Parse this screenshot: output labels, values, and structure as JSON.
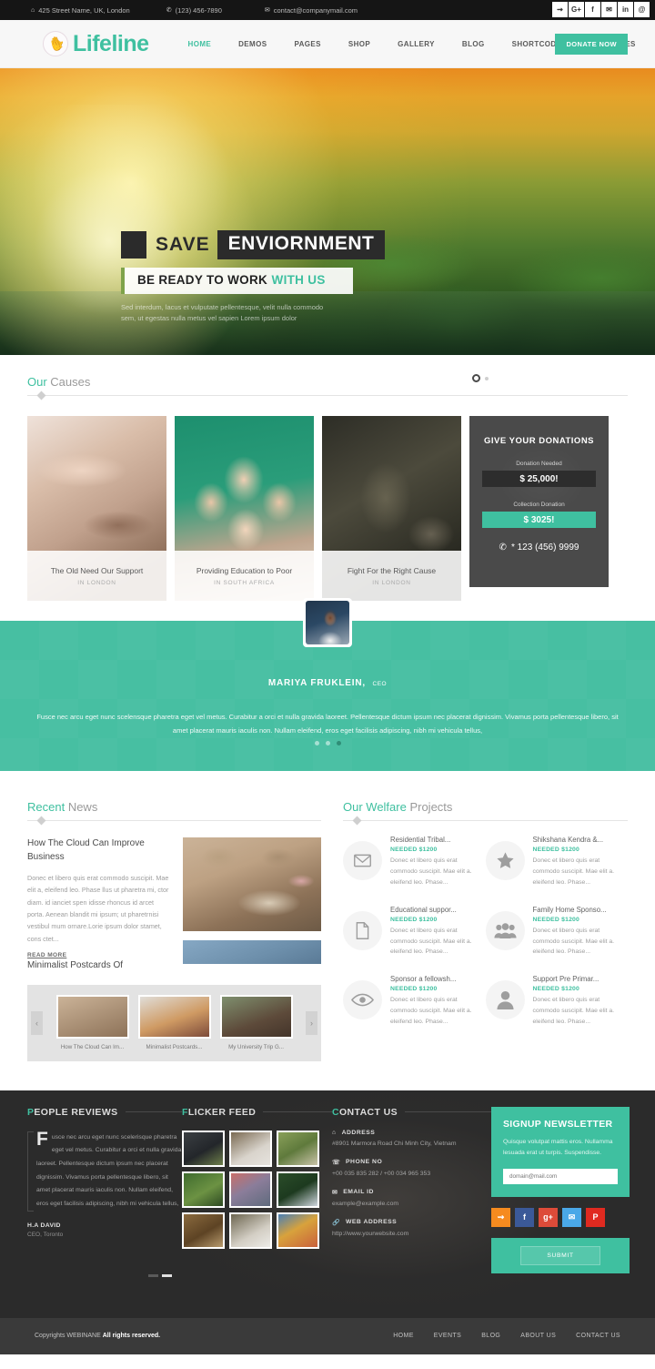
{
  "topbar": {
    "address": "425 Street Name, UK, London",
    "phone": "(123) 456-7890",
    "email": "contact@companymail.com",
    "social": [
      "rss-icon",
      "google-plus-icon",
      "facebook-icon",
      "twitter-icon",
      "linkedin-icon",
      "pinterest-icon"
    ],
    "social_glyphs": [
      "⇝",
      "G+",
      "f",
      "✉",
      "in",
      "@"
    ]
  },
  "header": {
    "logo_text": "Lifeline",
    "nav": [
      {
        "label": "HOME",
        "active": true
      },
      {
        "label": "DEMOS",
        "active": false
      },
      {
        "label": "PAGES",
        "active": false
      },
      {
        "label": "SHOP",
        "active": false
      },
      {
        "label": "GALLERY",
        "active": false
      },
      {
        "label": "BLOG",
        "active": false
      },
      {
        "label": "SHORTCODES",
        "active": false
      },
      {
        "label": "FEATURES",
        "active": false
      }
    ],
    "donate_label": "DONATE NOW",
    "accent": "#3fc0a0"
  },
  "hero": {
    "line1_a": "SAVE",
    "line1_b": "ENVIORNMENT",
    "line2_a": "BE READY TO WORK",
    "line2_b": "WITH US",
    "subtext": "Sed interdum, lacus et vulputate pellentesque, velit nulla commodo sem, ut egestas nulla metus vel sapien Lorem ipsum dolor"
  },
  "causes": {
    "title_accent": "Our",
    "title_rest": " Causes",
    "cards": [
      {
        "title": "The Old Need Our Support",
        "location": "IN LONDON"
      },
      {
        "title": "Providing Education to Poor",
        "location": "IN SOUTH AFRICA"
      },
      {
        "title": "Fight For the Right Cause",
        "location": "IN LONDON"
      }
    ],
    "donation": {
      "heading": "GIVE YOUR DONATIONS",
      "needed_label": "Donation Needed",
      "needed_value": "$ 25,000!",
      "collected_label": "Collection Donation",
      "collected_value": "$ 3025!",
      "phone": "* 123 (456) 9999"
    }
  },
  "testimonial": {
    "name": "MARIYA FRUKLEIN,",
    "role": "CEO",
    "text": "Fusce nec arcu eget nunc scelensque pharetra eget vel metus. Curabitur a orci et nulla gravida laoreet. Pellentesque dictum ipsum nec placerat dignissim. Vivamus porta pellentesque libero, sit amet placerat mauris iaculis non. Nullam eleifend, eros eget facilisis adipiscing, nibh mi vehicula tellus,",
    "bg": "#47bfa2"
  },
  "news": {
    "title_accent": "Recent",
    "title_rest": " News",
    "post_title": "How The Cloud Can Improve Business",
    "post_body": "Donec et libero quis erat commodo suscipit. Mae elit a, eleifend leo. Phase llus ut pharetra mi, ctor diam. id ianciet spen idisse rhoncus id arcet porta. Aenean blandit mi ipsum; ut pharetrnisi vestibul mum ornare.Lorie ipsum dolor stamet, cons ctet...",
    "read_more": "READ MORE",
    "post_title2": "Minimalist Postcards Of",
    "thumbs": [
      {
        "caption": "How The Cloud Can Im..."
      },
      {
        "caption": "Minimalist Postcards..."
      },
      {
        "caption": "My University Trip G..."
      }
    ]
  },
  "welfare": {
    "title_accent": "Our Welfare",
    "title_rest": " Projects",
    "items": [
      {
        "icon": "envelope-icon",
        "name": "Residential Tribal...",
        "needed": "NEEDED $1200",
        "desc": "Donec et libero quis erat commodo suscipit. Mae elit a. eleifend leo. Phase..."
      },
      {
        "icon": "star-icon",
        "name": "Shikshana Kendra &...",
        "needed": "NEEDED $1200",
        "desc": "Donec et libero quis erat commodo suscipit. Mae elit a. eleifend leo. Phase..."
      },
      {
        "icon": "document-icon",
        "name": "Educational suppor...",
        "needed": "NEEDED $1200",
        "desc": "Donec et libero quis erat commodo suscipit. Mae elit a. eleifend leo. Phase..."
      },
      {
        "icon": "group-icon",
        "name": "Family Home Sponso...",
        "needed": "NEEDED $1200",
        "desc": "Donec et libero quis erat commodo suscipit. Mae elit a. eleifend leo. Phase..."
      },
      {
        "icon": "eye-icon",
        "name": "Sponsor a fellowsh...",
        "needed": "NEEDED $1200",
        "desc": "Donec et libero quis erat commodo suscipit. Mae elit a. eleifend leo. Phase..."
      },
      {
        "icon": "user-icon",
        "name": "Support Pre Primar...",
        "needed": "NEEDED $1200",
        "desc": "Donec et libero quis erat commodo suscipit. Mae elit a. eleifend leo. Phase..."
      }
    ]
  },
  "footer": {
    "reviews": {
      "head_accent": "P",
      "head_rest": "EOPLE REVIEWS",
      "dropcap": "F",
      "text": "usce nec arcu eget nunc scelerisque pharetra eget vel metus. Curabitur a orci et nulla gravida laoreet. Pellentesque dictum ipsum nec placerat dignissim. Vivamus porta pellentesque libero, sit amet placerat mauris iaculis non. Nullam eleifend, eros eget facilisis adipiscing, nibh mi vehicula tellus,",
      "author": "H.A DAVID",
      "role": "CEO, Toronto"
    },
    "flicker": {
      "head_accent": "F",
      "head_rest": "LICKER FEED"
    },
    "contact": {
      "head_accent": "C",
      "head_rest": "ONTACT US",
      "items": [
        {
          "icon": "home-icon",
          "label": "ADDRESS",
          "value": "#8901 Marmora Road Chi Minh City, Vietnam"
        },
        {
          "icon": "phone-icon",
          "label": "PHONE NO",
          "value": "+00 035 835 282 / +00 034 965 353"
        },
        {
          "icon": "envelope-icon",
          "label": "EMAIL ID",
          "value": "example@example.com"
        },
        {
          "icon": "link-icon",
          "label": "WEB ADDRESS",
          "value": "http://www.yourwebsite.com"
        }
      ]
    },
    "newsletter": {
      "title": "SIGNUP NEWSLETTER",
      "desc": "Quisque volutpat mattis eros. Nullamma lesuada erat ut turpis. Suspendisse.",
      "placeholder": "domain@mail.com",
      "submit_label": "SUBMIT",
      "social": [
        {
          "name": "rss-icon",
          "glyph": "⇝",
          "color": "#f68b1f"
        },
        {
          "name": "facebook-icon",
          "glyph": "f",
          "color": "#3b5998"
        },
        {
          "name": "google-plus-icon",
          "glyph": "g+",
          "color": "#dd4b39"
        },
        {
          "name": "twitter-icon",
          "glyph": "✉",
          "color": "#4aa8e8"
        },
        {
          "name": "pinterest-icon",
          "glyph": "P",
          "color": "#e02a20"
        }
      ]
    }
  },
  "copyright": {
    "text_a": "Copyrights WEBINANE ",
    "text_b": "All rights reserved.",
    "links": [
      "HOME",
      "EVENTS",
      "BLOG",
      "ABOUT US",
      "CONTACT US"
    ]
  }
}
